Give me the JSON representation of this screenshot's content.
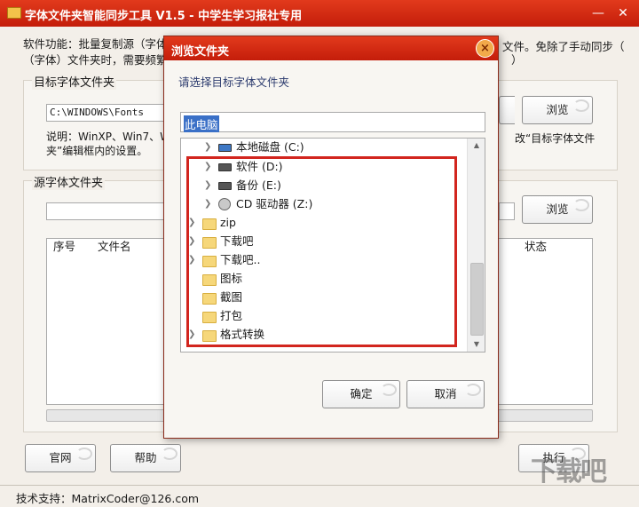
{
  "window": {
    "title": "字体文件夹智能同步工具 V1.5 - 中学生学习报社专用",
    "min_glyph": "—",
    "close_glyph": "✕"
  },
  "description": {
    "line1": "软件功能：批量复制源（字体",
    "line2": "（字体）文件夹时，需要频繁确",
    "line1_right": "文件。免除了手动同步（",
    "line2_right": "）"
  },
  "target_group": {
    "label": "目标字体文件夹",
    "path_value": "C:\\WINDOWS\\Fonts",
    "browse_label": "浏览",
    "note_line1": "说明：WinXP、Win7、Win",
    "note_line2": "夹”编辑框内的设置。",
    "note_right1": "改“目标字体文件",
    "note_right2": ""
  },
  "source_group": {
    "label": "源字体文件夹",
    "path_value": "",
    "browse_label": "浏览",
    "columns": [
      "序号",
      "文件名",
      "状态"
    ]
  },
  "buttons": {
    "website": "官网",
    "help": "帮助",
    "execute": "执行"
  },
  "status_bar": {
    "text": "技术支持：MatrixCoder@126.com"
  },
  "watermark": "下载吧",
  "dialog": {
    "title": "浏览文件夹",
    "close_glyph": "×",
    "prompt": "请选择目标字体文件夹",
    "selected_path": "此电脑",
    "ok_label": "确定",
    "cancel_label": "取消",
    "tree": [
      {
        "label": "本地磁盘 (C:)",
        "icon": "system-drive-icon",
        "expandable": true
      },
      {
        "label": "软件 (D:)",
        "icon": "drive-icon",
        "expandable": true
      },
      {
        "label": "备份 (E:)",
        "icon": "drive-icon",
        "expandable": true
      },
      {
        "label": "CD 驱动器 (Z:)",
        "icon": "cd-drive-icon",
        "expandable": true
      },
      {
        "label": "zip",
        "icon": "folder-icon",
        "expandable": true
      },
      {
        "label": "下载吧",
        "icon": "folder-icon",
        "expandable": true
      },
      {
        "label": "下载吧..",
        "icon": "folder-icon",
        "expandable": true
      },
      {
        "label": "图标",
        "icon": "folder-icon",
        "expandable": false
      },
      {
        "label": "截图",
        "icon": "folder-icon",
        "expandable": false
      },
      {
        "label": "打包",
        "icon": "folder-icon",
        "expandable": false
      },
      {
        "label": "格式转换",
        "icon": "folder-icon",
        "expandable": true
      }
    ]
  },
  "colors": {
    "title_red": "#d62c14",
    "highlight_box": "#d2251e",
    "selection_blue": "#3a70c7"
  }
}
